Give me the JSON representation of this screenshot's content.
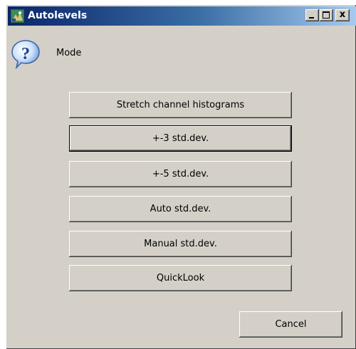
{
  "window": {
    "title": "Autolevels",
    "controls": [
      "minimize",
      "maximize",
      "close"
    ],
    "close_glyph": "x"
  },
  "dialog": {
    "icon": "question-icon",
    "label": "Mode",
    "options": [
      "Stretch channel histograms",
      "+-3 std.dev.",
      "+-5 std.dev.",
      "Auto std.dev.",
      "Manual std.dev.",
      "QuickLook"
    ],
    "focused_option": "+-3 std.dev.",
    "cancel_label": "Cancel"
  },
  "colors": {
    "title_gradient_start": "#0a246a",
    "title_gradient_end": "#a6caf0",
    "face": "#d4d0c8"
  }
}
